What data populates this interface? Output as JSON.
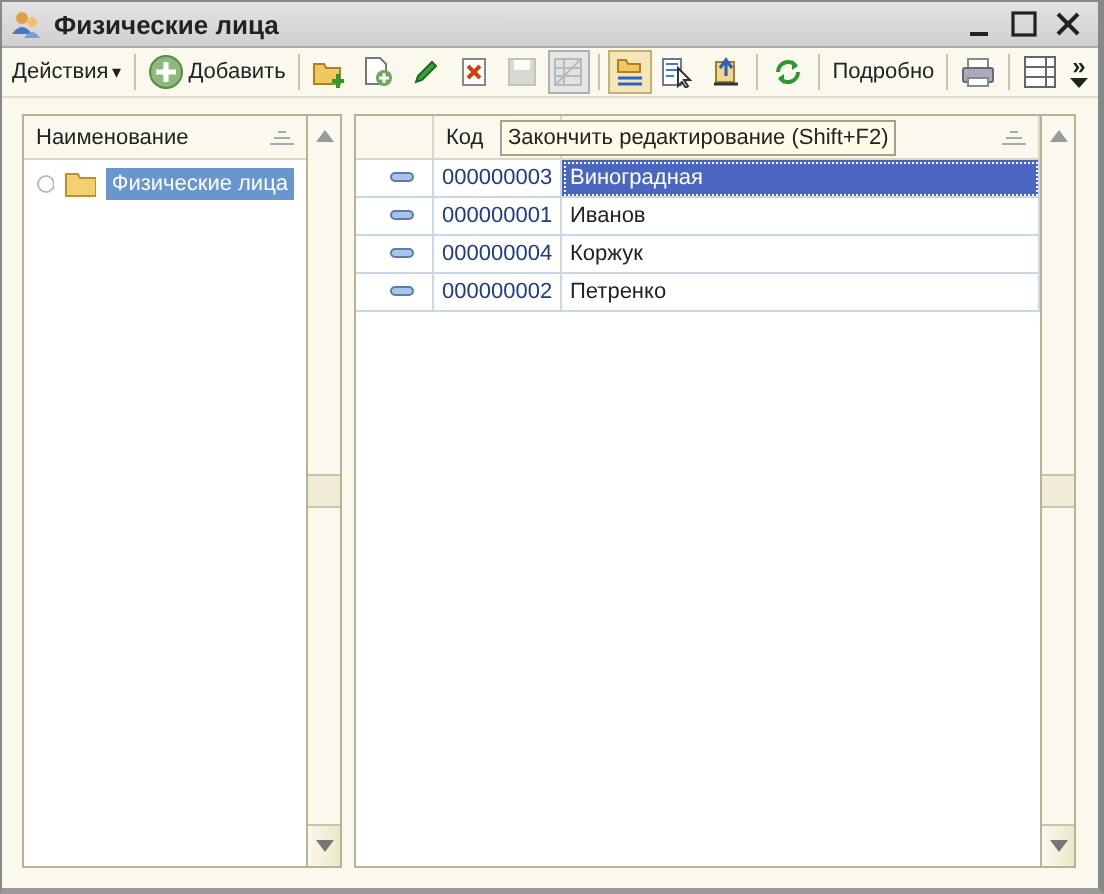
{
  "window": {
    "title": "Физические лица"
  },
  "toolbar": {
    "actions_label": "Действия",
    "actions_caret": "▾",
    "add_label": "Добавить",
    "details_label": "Подробно",
    "tools": [
      {
        "kind": "add-folder",
        "disabled": false,
        "pressed": false
      },
      {
        "kind": "copy",
        "disabled": false,
        "pressed": false
      },
      {
        "kind": "edit",
        "disabled": false,
        "pressed": false
      },
      {
        "kind": "delete",
        "disabled": false,
        "pressed": false
      },
      {
        "kind": "save",
        "disabled": true,
        "pressed": false
      },
      {
        "kind": "grid",
        "disabled": true,
        "pressed": true
      },
      {
        "kind": "hierarchy",
        "disabled": false,
        "pressed": true
      },
      {
        "kind": "select",
        "disabled": false,
        "pressed": false
      },
      {
        "kind": "up-level",
        "disabled": false,
        "pressed": false
      },
      {
        "kind": "refresh",
        "disabled": false,
        "pressed": false
      }
    ],
    "overflow": "»"
  },
  "tree": {
    "header": "Наименование",
    "items": [
      {
        "label": "Физические лица",
        "selected": true
      }
    ]
  },
  "table": {
    "columns": [
      "Код"
    ],
    "rows": [
      {
        "code": "000000003",
        "name": "Виноградная",
        "selected": true
      },
      {
        "code": "000000001",
        "name": "Иванов",
        "selected": false
      },
      {
        "code": "000000004",
        "name": "Коржук",
        "selected": false
      },
      {
        "code": "000000002",
        "name": "Петренко",
        "selected": false
      }
    ]
  },
  "tooltip": "Закончить редактирование (Shift+F2)"
}
